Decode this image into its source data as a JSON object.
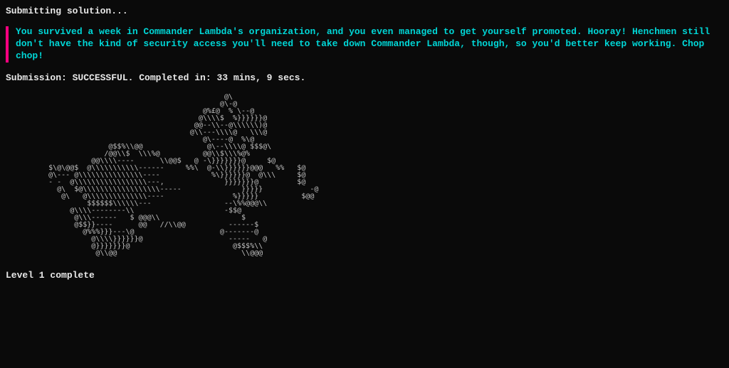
{
  "header": {
    "submitting": "Submitting solution..."
  },
  "quote": {
    "text": "You survived a week in Commander Lambda's organization, and you even managed to get yourself promoted. Hooray! Henchmen still don't have the kind of security access you'll need to take down Commander Lambda, though, so you'd better keep working. Chop chop!"
  },
  "submission": {
    "text": "Submission: SUCCESSFUL. Completed in: 33 mins, 9 secs."
  },
  "ascii_art": "                                              @\\\n                                             @\\-@\n                                         @%£@  % \\--@\n                                        @\\\\\\\\$  %}}}}}}@\n                                       @@--\\\\--@\\\\\\\\\\\\)@\n                                      @\\\\---\\\\\\\\@   \\\\\\@\n                                         @\\----@  %\\@\n                   @$$%\\\\@@               @\\--\\\\\\\\@ $$$@\\\n                  /@@\\\\$  \\\\\\%@          @@\\\\$\\\\\\%@%\n               @@\\\\\\\\----      \\\\@@$   @ -\\}}}}}}}@     $@\n     $\\@\\@@$  @\\\\\\\\\\\\\\\\\\\\\\------     %%\\  @-\\\\}}}}}}@@@   %%   $@\n     @\\--- @\\\\\\\\\\\\\\\\\\\\\\\\\\\\\\----            %\\}}}}}}@  @\\\\\\     $@\n     - -  @\\\\\\\\\\\\\\\\\\\\\\\\\\\\\\\\\\---,              }}}}}}}@         $@\n       @\\  $@\\\\\\\\\\\\\\\\\\\\\\\\\\\\\\\\\\\\-----              }}}}}           -@\n        @\\   @\\\\\\\\\\\\\\\\\\\\\\\\\\\\----                %}}}}}          $@@\n              $$$$$$\\\\\\\\\\\\---                 --\\%%@@@\\\\\n          @\\\\\\\\--------\\\\                     -$$@\n           @\\\\\\------   $ @@@\\\\                   $\n           @$$}}----      @@   //\\\\@@          ------$\n             @%%%}}}---\\@                    @-------@\n               @\\\\\\\\}}}}}}@                    -----   @\n               @}}}}}}}@                        @$$$%\\\\\n                @\\\\@@                             \\\\@@@",
  "footer": {
    "level": "Level 1 complete"
  }
}
